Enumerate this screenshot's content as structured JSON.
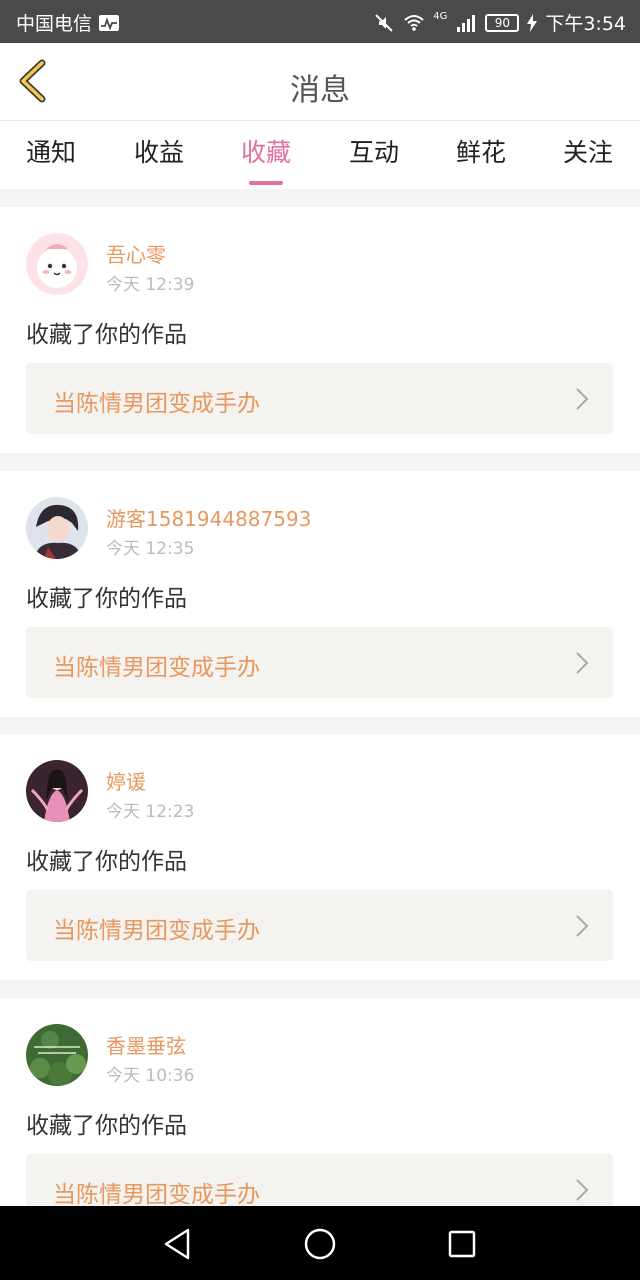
{
  "status_bar": {
    "carrier": "中国电信",
    "network": "4G",
    "battery": "90",
    "time": "下午3:54"
  },
  "header": {
    "title": "消息",
    "back_icon": "chevron-left-icon"
  },
  "tabs": [
    {
      "label": "通知",
      "active": false
    },
    {
      "label": "收益",
      "active": false
    },
    {
      "label": "收藏",
      "active": true
    },
    {
      "label": "互动",
      "active": false
    },
    {
      "label": "鲜花",
      "active": false
    },
    {
      "label": "关注",
      "active": false
    }
  ],
  "colors": {
    "accent": "#e5709e",
    "username": "#e89760",
    "time": "#bbbbbb"
  },
  "notifications": [
    {
      "username": "吾心零",
      "time": "今天 12:39",
      "message": "收藏了你的作品",
      "work_title": "当陈情男团变成手办"
    },
    {
      "username": "游客1581944887593",
      "time": "今天 12:35",
      "message": "收藏了你的作品",
      "work_title": "当陈情男团变成手办"
    },
    {
      "username": "婷谖",
      "time": "今天 12:23",
      "message": "收藏了你的作品",
      "work_title": "当陈情男团变成手办"
    },
    {
      "username": "香墨垂弦",
      "time": "今天 10:36",
      "message": "收藏了你的作品",
      "work_title": "当陈情男团变成手办"
    }
  ]
}
